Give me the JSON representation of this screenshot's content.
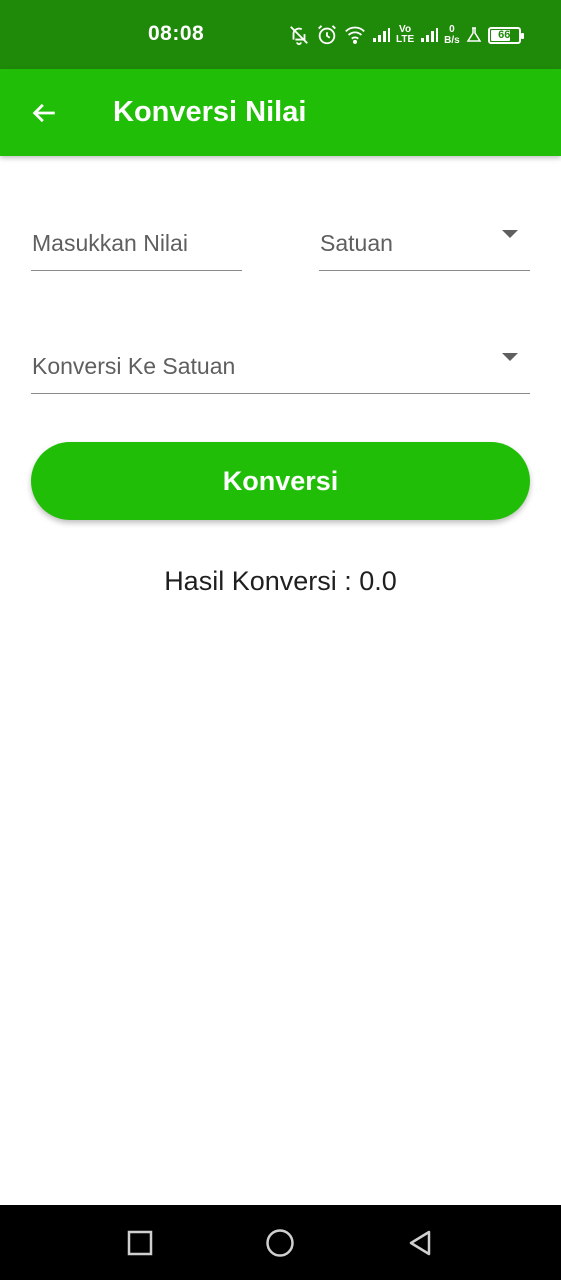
{
  "status_bar": {
    "time": "08:08",
    "net_speed_value": "0",
    "net_speed_unit": "B/s",
    "volte_top": "Vo",
    "volte_bottom": "LTE",
    "battery_level": "66",
    "icons": [
      "bell-off-icon",
      "alarm-icon",
      "wifi-icon",
      "signal-icon",
      "volte-icon",
      "signal-icon",
      "net-speed",
      "flask-icon",
      "battery-icon"
    ]
  },
  "app_bar": {
    "title": "Konversi Nilai",
    "back_icon": "arrow-left-icon"
  },
  "form": {
    "value_placeholder": "Masukkan Nilai",
    "unit_from_placeholder": "Satuan",
    "unit_to_placeholder": "Konversi Ke Satuan"
  },
  "convert_button_label": "Konversi",
  "result_text": "Hasil Konversi : 0.0",
  "nav_bar": {
    "icons": [
      "square-icon",
      "circle-icon",
      "triangle-back-icon"
    ]
  },
  "colors": {
    "status_bar": "#1f8a09",
    "app_bar": "#20be07",
    "button": "#20be07"
  }
}
